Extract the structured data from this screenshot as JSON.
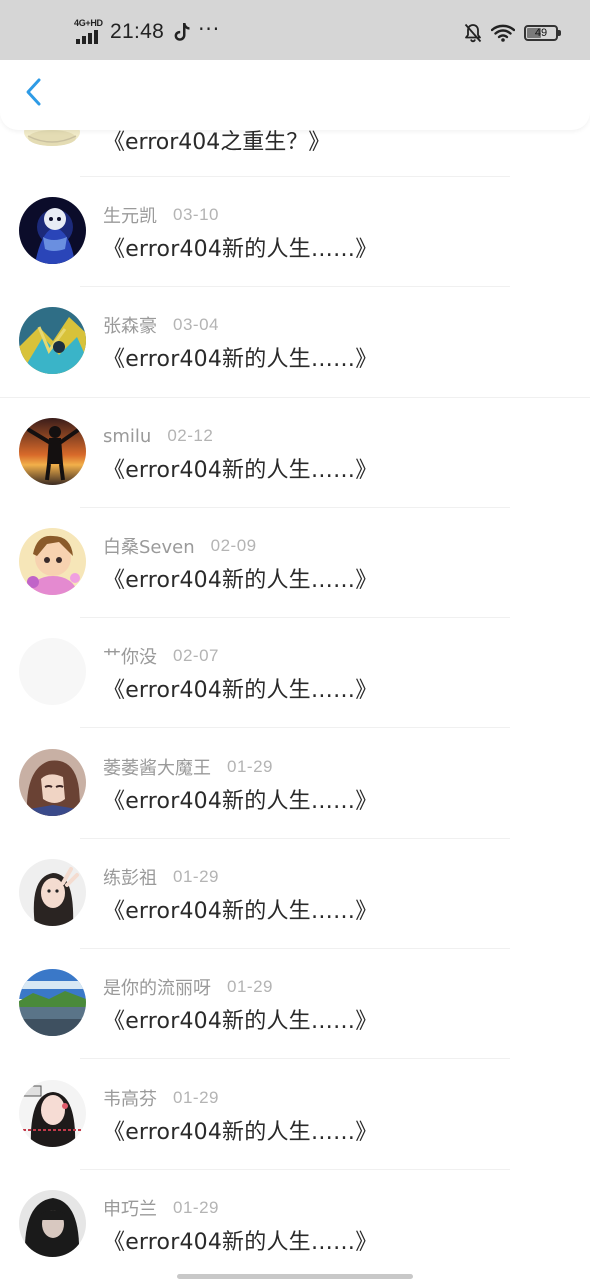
{
  "status_bar": {
    "network": "4G+HD",
    "time": "21:48",
    "more": "···",
    "battery": "49",
    "battery_level": 0.49,
    "icons": [
      "tiktok-icon",
      "mute-bell-icon",
      "wifi-icon",
      "battery-icon"
    ]
  },
  "header": {
    "back_icon": "chevron-left-icon",
    "accent_color": "#2e9be6"
  },
  "partial_item": {
    "title": "《error404之重生？》"
  },
  "items": [
    {
      "name": "生元凯",
      "date": "03-10",
      "title": "《error404新的人生……》"
    },
    {
      "name": "张森豪",
      "date": "03-04",
      "title": "《error404新的人生……》"
    },
    {
      "name": "smilu",
      "date": "02-12",
      "title": "《error404新的人生……》"
    },
    {
      "name": "白桑Seven",
      "date": "02-09",
      "title": "《error404新的人生……》"
    },
    {
      "name": "艹你没",
      "date": "02-07",
      "title": "《error404新的人生……》"
    },
    {
      "name": "萎萎酱大魔王",
      "date": "01-29",
      "title": "《error404新的人生……》"
    },
    {
      "name": "练彭祖",
      "date": "01-29",
      "title": "《error404新的人生……》"
    },
    {
      "name": "是你的流丽呀",
      "date": "01-29",
      "title": "《error404新的人生……》"
    },
    {
      "name": "韦高芬",
      "date": "01-29",
      "title": "《error404新的人生……》"
    },
    {
      "name": "申巧兰",
      "date": "01-29",
      "title": "《error404新的人生……》"
    }
  ]
}
